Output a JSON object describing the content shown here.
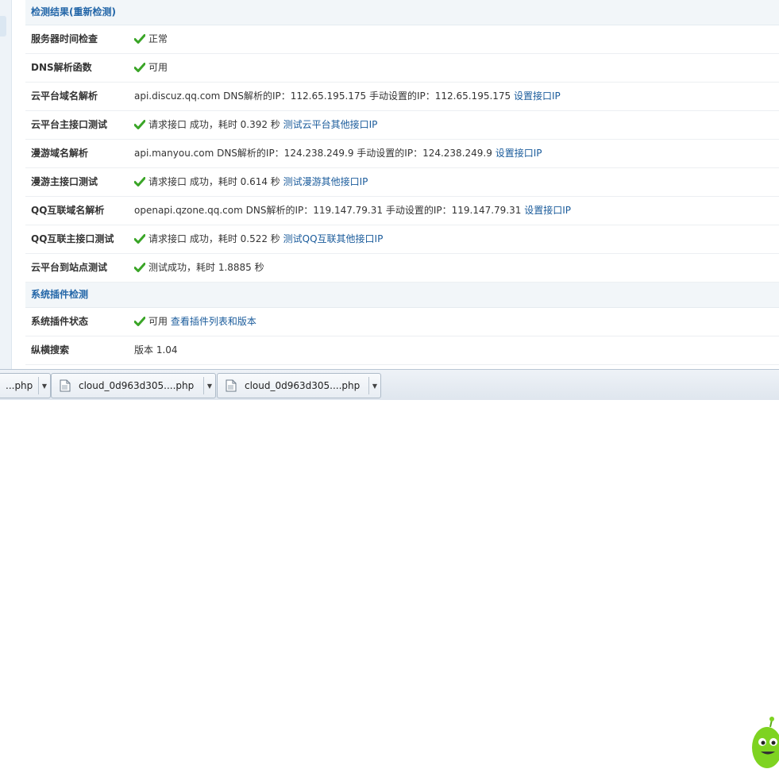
{
  "section1": {
    "title": "检测结果",
    "action": "(重新检测)"
  },
  "rows1": [
    {
      "label": "服务器时间检查",
      "ok": true,
      "text": "正常",
      "link": ""
    },
    {
      "label": "DNS解析函数",
      "ok": true,
      "text": "可用",
      "link": ""
    },
    {
      "label": "云平台域名解析",
      "ok": false,
      "text": "api.discuz.qq.com DNS解析的IP：112.65.195.175 手动设置的IP：112.65.195.175",
      "link": "设置接口IP"
    },
    {
      "label": "云平台主接口测试",
      "ok": true,
      "text": "请求接口 成功，耗时 0.392 秒",
      "link": "测试云平台其他接口IP"
    },
    {
      "label": "漫游域名解析",
      "ok": false,
      "text": "api.manyou.com DNS解析的IP：124.238.249.9 手动设置的IP：124.238.249.9",
      "link": "设置接口IP"
    },
    {
      "label": "漫游主接口测试",
      "ok": true,
      "text": "请求接口 成功，耗时 0.614 秒",
      "link": "测试漫游其他接口IP"
    },
    {
      "label": "QQ互联域名解析",
      "ok": false,
      "text": "openapi.qzone.qq.com DNS解析的IP：119.147.79.31 手动设置的IP：119.147.79.31",
      "link": "设置接口IP"
    },
    {
      "label": "QQ互联主接口测试",
      "ok": true,
      "text": "请求接口 成功，耗时 0.522 秒",
      "link": "测试QQ互联其他接口IP"
    },
    {
      "label": "云平台到站点测试",
      "ok": true,
      "text": "测试成功，耗时 1.8885 秒",
      "link": ""
    }
  ],
  "section2": {
    "title": "系统插件检测"
  },
  "rows2": [
    {
      "label": "系统插件状态",
      "ok": true,
      "text": "可用",
      "link": "查看插件列表和版本"
    },
    {
      "label": "纵横搜索",
      "ok": false,
      "text": "版本 1.04",
      "link": ""
    }
  ],
  "taskbar": {
    "items": [
      {
        "name": "...php"
      },
      {
        "name": "cloud_0d963d305....php"
      },
      {
        "name": "cloud_0d963d305....php"
      }
    ]
  },
  "colors": {
    "link": "#1a5b9b",
    "header_text": "#2366a8",
    "check": "#3aa527"
  }
}
